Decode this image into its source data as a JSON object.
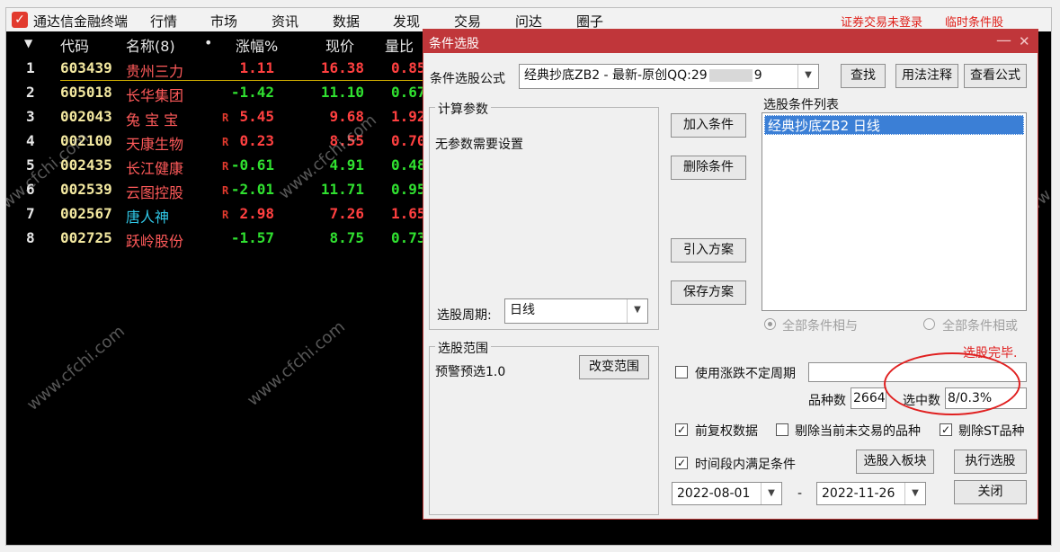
{
  "app": {
    "title": "通达信金融终端",
    "menu": [
      "行情",
      "市场",
      "资讯",
      "数据",
      "发现",
      "交易",
      "问达",
      "圈子"
    ],
    "status_login": "证券交易未登录",
    "status_cond": "临时条件股"
  },
  "table": {
    "headers": {
      "sort": "▼",
      "code": "代码",
      "name": "名称(8)",
      "dot": "•",
      "change": "涨幅%",
      "price": "现价",
      "ratio": "量比"
    },
    "rows": [
      {
        "idx": "1",
        "code": "603439",
        "name": "贵州三力",
        "r": "",
        "change": "1.11",
        "price": "16.38",
        "ratio": "0.85",
        "dir": "up"
      },
      {
        "idx": "2",
        "code": "605018",
        "name": "长华集团",
        "r": "",
        "change": "-1.42",
        "price": "11.10",
        "ratio": "0.67",
        "dir": "down"
      },
      {
        "idx": "3",
        "code": "002043",
        "name": "兔 宝 宝",
        "r": "R",
        "change": "5.45",
        "price": "9.68",
        "ratio": "1.92",
        "dir": "up"
      },
      {
        "idx": "4",
        "code": "002100",
        "name": "天康生物",
        "r": "R",
        "change": "0.23",
        "price": "8.55",
        "ratio": "0.70",
        "dir": "up"
      },
      {
        "idx": "5",
        "code": "002435",
        "name": "长江健康",
        "r": "R",
        "change": "-0.61",
        "price": "4.91",
        "ratio": "0.48",
        "dir": "down"
      },
      {
        "idx": "6",
        "code": "002539",
        "name": "云图控股",
        "r": "R",
        "change": "-2.01",
        "price": "11.71",
        "ratio": "0.95",
        "dir": "down"
      },
      {
        "idx": "7",
        "code": "002567",
        "name": "唐人神",
        "r": "R",
        "change": "2.98",
        "price": "7.26",
        "ratio": "1.65",
        "dir": "up"
      },
      {
        "idx": "8",
        "code": "002725",
        "name": "跃岭股份",
        "r": "",
        "change": "-1.57",
        "price": "8.75",
        "ratio": "0.73",
        "dir": "down"
      }
    ]
  },
  "watermark": "www.cfchi.com",
  "dialog": {
    "title": "条件选股",
    "min": "—",
    "close": "✕",
    "formula_label": "条件选股公式",
    "formula_value": "经典抄底ZB2  - 最新-原创QQ:29",
    "formula_tail": "9",
    "btn_find": "查找",
    "btn_usage": "用法注释",
    "btn_view": "查看公式",
    "params_title": "计算参数",
    "params_text": "无参数需要设置",
    "period_label": "选股周期:",
    "period_value": "日线",
    "btn_add": "加入条件",
    "btn_delete": "删除条件",
    "btn_import": "引入方案",
    "btn_save": "保存方案",
    "list_title": "选股条件列表",
    "list_items": [
      "经典抄底ZB2  日线"
    ],
    "radio_and": "全部条件相与",
    "radio_or": "全部条件相或",
    "done_text": "选股完毕.",
    "range_title": "选股范围",
    "range_value": "预警预选1.0",
    "btn_change_range": "改变范围",
    "use_period": "使用涨跌不定周期",
    "count_label": "品种数",
    "count_value": "2664",
    "selected_label": "选中数",
    "selected_value": "8/0.3%",
    "chk_fq": "前复权数据",
    "chk_exclude_untraded": "剔除当前未交易的品种",
    "chk_exclude_st": "剔除ST品种",
    "chk_time": "时间段内满足条件",
    "btn_to_board": "选股入板块",
    "btn_execute": "执行选股",
    "date_from": "2022-08-01",
    "date_sep": "-",
    "date_to": "2022-11-26",
    "btn_close": "关闭",
    "check_mark": "✓",
    "dd_arrow": "▼"
  }
}
